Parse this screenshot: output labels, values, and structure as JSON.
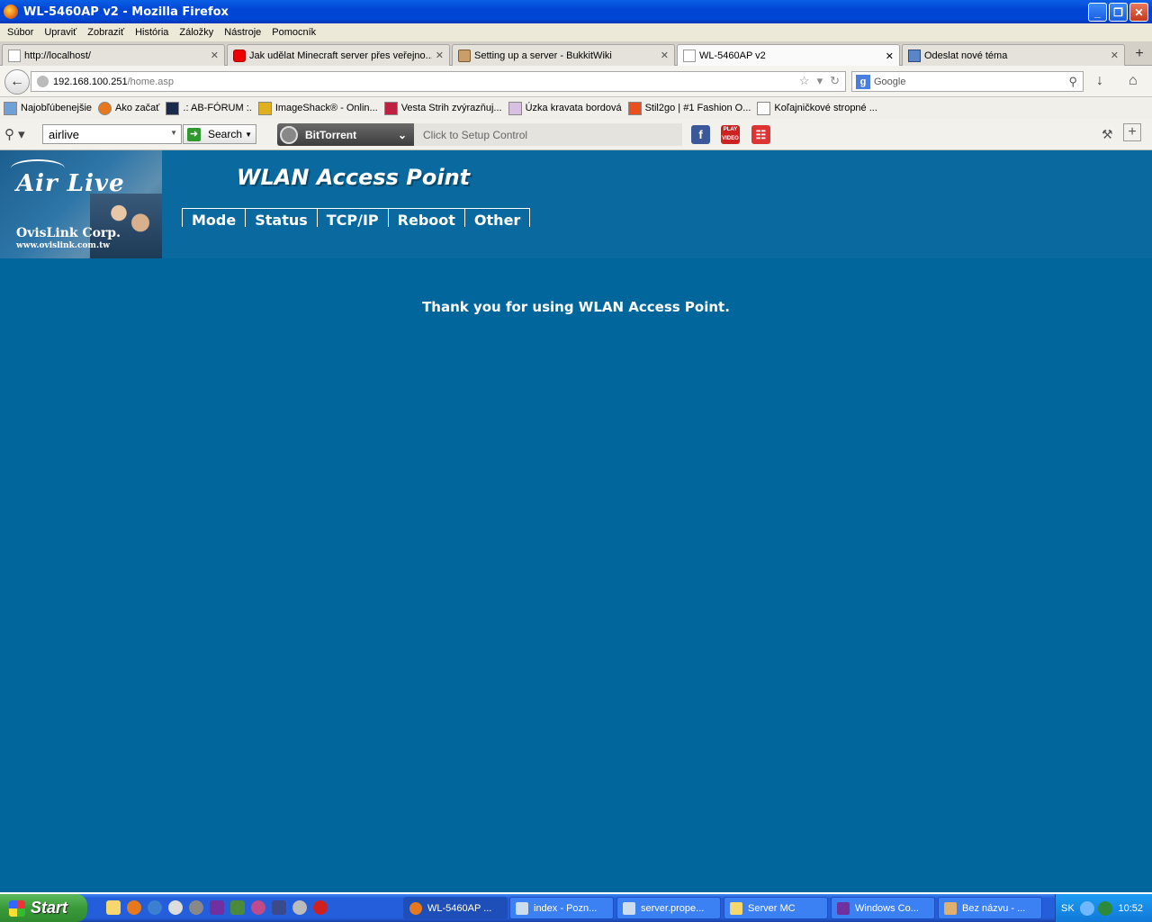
{
  "window": {
    "title": "WL-5460AP v2 - Mozilla Firefox",
    "buttons": [
      "_",
      "❐",
      "✕"
    ]
  },
  "menu_bar": [
    "Súbor",
    "Upraviť",
    "Zobraziť",
    "História",
    "Záložky",
    "Nástroje",
    "Pomocník"
  ],
  "tabs": [
    {
      "label": "http://localhost/",
      "icon": "blank-page-icon"
    },
    {
      "label": "Jak udělat Minecraft server přes veřejno...",
      "icon": "youtube-icon"
    },
    {
      "label": "Setting up a server - BukkitWiki",
      "icon": "bukkit-icon"
    },
    {
      "label": "WL-5460AP v2",
      "icon": "blank-page-icon",
      "active": true
    },
    {
      "label": "Odeslat nové téma",
      "icon": "computer-icon"
    }
  ],
  "nav": {
    "url_host": "192.168.100.251",
    "url_path": "/home.asp",
    "search_placeholder": "Google"
  },
  "bookmarks": [
    "Najobľúbenejšie",
    "Ako začať",
    ".: AB-FÓRUM :.",
    "ImageShack® - Onlin...",
    "Vesta Strih zvýrazňuj...",
    "Úzka kravata bordová",
    "Stil2go | #1 Fashion O...",
    "Koľajničkové stropné ..."
  ],
  "toolbar": {
    "search_value": "airlive",
    "search_button": "Search",
    "bittorrent_label": "BitTorrent",
    "control_placeholder": "Click to Setup Control",
    "play_video_label": "PLAY VIDEO"
  },
  "page": {
    "logo_brand": "Air Live",
    "logo_corp": "OvisLink Corp.",
    "logo_url": "www.ovislink.com.tw",
    "title": "WLAN Access Point",
    "menu": [
      "Mode",
      "Status",
      "TCP/IP",
      "Reboot",
      "Other"
    ],
    "message": "Thank you for using WLAN Access Point."
  },
  "taskbar": {
    "start_label": "Start",
    "tasks": [
      {
        "label": "WL-5460AP ...",
        "active": true
      },
      {
        "label": "index - Pozn..."
      },
      {
        "label": "server.prope..."
      },
      {
        "label": "Server MC"
      },
      {
        "label": "Windows Co..."
      },
      {
        "label": "Bez názvu - ..."
      }
    ],
    "language": "SK",
    "clock": "10:52"
  }
}
